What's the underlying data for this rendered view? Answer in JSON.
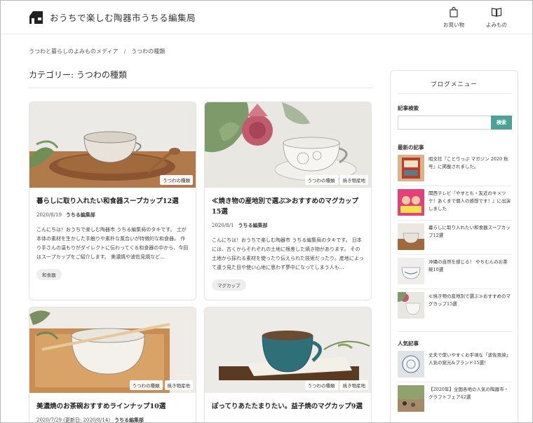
{
  "header": {
    "site_title": "おうちで楽しむ陶器市うちる編集局",
    "nav": [
      {
        "label": "お買い物",
        "icon": "shopping-bag-icon"
      },
      {
        "label": "よみもの",
        "icon": "book-icon"
      }
    ]
  },
  "breadcrumb": {
    "home": "うつわと暮らしのよみものメディア",
    "separator": "/",
    "current": "うつわの種類"
  },
  "category": {
    "title": "カテゴリー: うつわの種類"
  },
  "articles": [
    {
      "title": "暮らしに取り入れたい和食器スープカップ12選",
      "date": "2020/8/19",
      "author": "うちる編集部",
      "excerpt": "こんにちは！おうちで楽しむ陶器市 うちる編集局のタキです。 土が本体の素材を生かした手触りや素朴な風合いが特徴的な和食器。 作り手さんの温もりがダイレクトに伝わってくる和食器の中から、今回はスープカップをご紹介します。 美濃焼や波佐見焼など…",
      "tags": [
        "うつわの種類"
      ],
      "chip": "和食器"
    },
    {
      "title": "≪焼き物の産地別で選ぶ≫おすすめのマグカップ15選",
      "date": "2020/8/1",
      "author": "うちる編集部",
      "excerpt": "こんにちは！おうちで楽しむ陶器市 うちる編集局のタキです。 日本には、古くからそれぞれの土地に根差した焼き物があります。 その土地から採れる素材を使ったり伝えられた技術だったり。産地によって違う見た目や使い心地に思わず夢中になってしまう人も…",
      "tags": [
        "うつわの種類",
        "焼き物産地"
      ],
      "chip": "マグカップ"
    },
    {
      "title": "美濃焼のお茶碗おすすめラインナップ10選",
      "date": "2020/7/29 (更新日: 2020/8/14)",
      "author": "うちる編集部",
      "tags": [
        "うつわの種類",
        "焼き物産地"
      ]
    },
    {
      "title": "ぽってりあたたまりたい。益子焼のマグカップ9選",
      "tags": [
        "うつわの種類",
        "焼き物産地"
      ]
    }
  ],
  "sidebar": {
    "title": "ブログメニュー",
    "search": {
      "heading": "記事検索",
      "placeholder": "",
      "button": "検索"
    },
    "latest": {
      "heading": "最新の記事",
      "items": [
        "昭文社『ことりっぷ マガジン 2020 秋号』に掲載されました。",
        "関西テレビ『やすとも・友近のキメツケ！あくまで個人の感想です！』に出演しました",
        "暮らしに取り入れたい和食器スープカップ12選",
        "沖縄の自然を感じる！ やちむんのお茶碗10選",
        "≪焼き物の産地別で選ぶ≫おすすめのマグカップ15選"
      ]
    },
    "popular": {
      "heading": "人気記事",
      "items": [
        "丈夫で使いやすくお手頃な「波佐見焼」人気の窯元&ブランド15選！",
        "【2020年】全国各地の人気の陶器市・クラフトフェア42選"
      ]
    }
  },
  "colors": {
    "accent": "#4aa394",
    "border": "#e2e2e2",
    "text": "#333333"
  }
}
